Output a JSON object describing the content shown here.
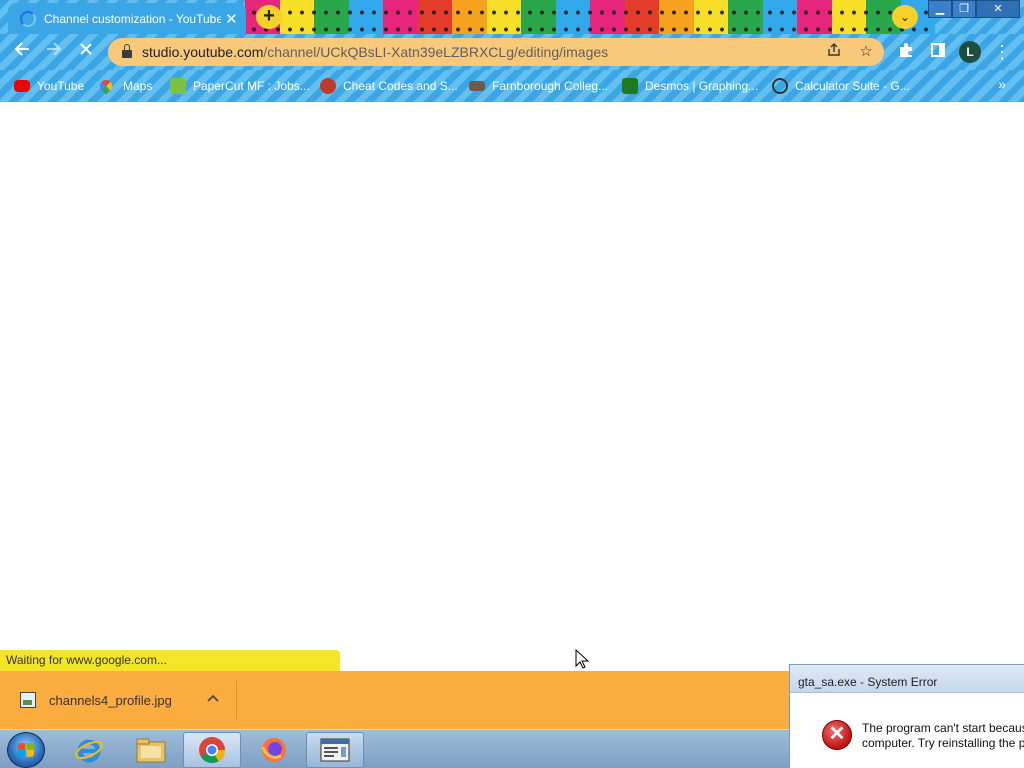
{
  "browser": {
    "tab": {
      "title": "Channel customization - YouTube Studio"
    },
    "url": {
      "host": "studio.youtube.com",
      "path": "/channel/UCkQBsLI-Xatn39eLZBRXCLg/editing/images"
    },
    "profile_initial": "L",
    "bookmarks": [
      {
        "label": "YouTube",
        "icon": "youtube-icon"
      },
      {
        "label": "Maps",
        "icon": "maps-icon"
      },
      {
        "label": "PaperCut MF : Jobs...",
        "icon": "papercut-icon"
      },
      {
        "label": "Cheat Codes and S...",
        "icon": "cheatcodes-icon"
      },
      {
        "label": "Farnborough Colleg...",
        "icon": "college-icon"
      },
      {
        "label": "Desmos | Graphing...",
        "icon": "desmos-icon"
      },
      {
        "label": "Calculator Suite - G...",
        "icon": "geogebra-icon"
      }
    ],
    "status_text": "Waiting for www.google.com..."
  },
  "downloads": {
    "file_name": "channels4_profile.jpg"
  },
  "error_dialog": {
    "title": "gta_sa.exe - System Error",
    "line1": "The program can't start becaus",
    "line2": "computer. Try reinstalling the p"
  },
  "taskbar": {
    "apps": [
      "start-button",
      "internet-explorer",
      "file-explorer",
      "google-chrome",
      "firefox",
      "windows-app"
    ]
  },
  "colors": {
    "theme_blue": "#3aa6e6",
    "omnibox": "#f9c97b",
    "status_bubble": "#f4e528",
    "download_shelf": "#fbad3f"
  }
}
